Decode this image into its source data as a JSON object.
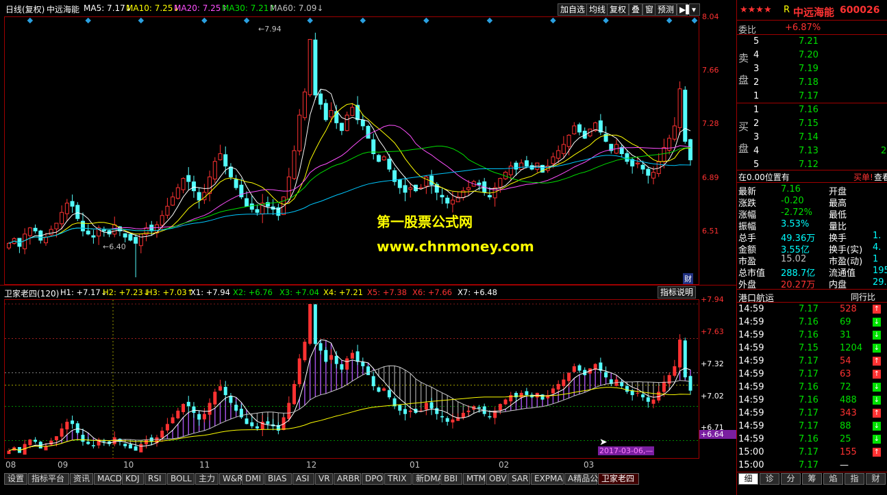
{
  "main": {
    "header": {
      "label": "日线(复权)",
      "stock_name": "中远海能",
      "ma5": "MA5: 7.17↓",
      "ma10": "MA10: 7.25↓",
      "ma20": "MA20: 7.25↑",
      "ma30": "MA30: 7.21↑",
      "ma60": "MA60: 7.09↓"
    },
    "buttons": [
      "加自选",
      "均线",
      "复权",
      "叠",
      "窗",
      "预测"
    ],
    "y_ticks": [
      "8.04",
      "7.66",
      "7.28",
      "6.89",
      "6.51"
    ],
    "annotations": {
      "high": "7.94",
      "low": "6.40"
    },
    "watermark1": "第一股票公式网",
    "watermark2": "www.chnmoney.com",
    "cai_label": "财"
  },
  "indicator": {
    "name": "卫家老四(120)",
    "values": [
      {
        "text": "H1: +7.17↓",
        "color": "#ffffff"
      },
      {
        "text": "H2: +7.23↓",
        "color": "#ffff00"
      },
      {
        "text": "H3: +7.03↑",
        "color": "#ffff00"
      },
      {
        "text": "X1: +7.94",
        "color": "#ffffff"
      },
      {
        "text": "X2: +6.76",
        "color": "#00e000"
      },
      {
        "text": "X3: +7.04",
        "color": "#00e000"
      },
      {
        "text": "X4: +7.21",
        "color": "#ffff00"
      },
      {
        "text": "X5: +7.38",
        "color": "#ff3232"
      },
      {
        "text": "X6: +7.66",
        "color": "#ff3232"
      },
      {
        "text": "X7: +6.48",
        "color": "#ffffff"
      }
    ],
    "help_button": "指标说明",
    "y_ticks": [
      "+7.94",
      "+7.63",
      "+7.32",
      "+7.02",
      "+6.71",
      "+6.64"
    ],
    "date_label": "2017-03-06,—"
  },
  "x_axis": [
    "08",
    "09",
    "10",
    "11",
    "12",
    "01",
    "02",
    "03"
  ],
  "tabs": [
    "设置",
    "指标平台",
    "资讯",
    "MACD",
    "KDJ",
    "RSI",
    "BOLL",
    "主力",
    "W&R",
    "DMI",
    "BIAS",
    "ASI",
    "VR",
    "ARBR",
    "DPO",
    "TRIX",
    "新DMA",
    "BBI",
    "MTM",
    "OBV",
    "SAR",
    "EXPMA",
    "A精品公式",
    "卫家老四"
  ],
  "right_panel": {
    "stars": "★★★★",
    "r": "R",
    "name": "中远海能",
    "code": "600026",
    "weibi_label": "委比",
    "weibi_value": "+6.87%",
    "sell_label": [
      "卖",
      "盘"
    ],
    "buy_label": [
      "买",
      "盘"
    ],
    "sell": [
      {
        "n": "5",
        "p": "7.21"
      },
      {
        "n": "4",
        "p": "7.20"
      },
      {
        "n": "3",
        "p": "7.19"
      },
      {
        "n": "2",
        "p": "7.18"
      },
      {
        "n": "1",
        "p": "7.17"
      }
    ],
    "buy": [
      {
        "n": "1",
        "p": "7.16",
        "v": ""
      },
      {
        "n": "2",
        "p": "7.15",
        "v": ""
      },
      {
        "n": "3",
        "p": "7.14",
        "v": ""
      },
      {
        "n": "4",
        "p": "7.13",
        "v": "2"
      },
      {
        "n": "5",
        "p": "7.12",
        "v": ""
      }
    ],
    "position_label": "在0.00位置有",
    "buy_action": "买单!",
    "view_action": "查看",
    "stats": [
      {
        "k": "最新",
        "v": "7.16",
        "vc": "#00e000",
        "k2": "开盘"
      },
      {
        "k": "涨跌",
        "v": "-0.20",
        "vc": "#00e000",
        "k2": "最高"
      },
      {
        "k": "涨幅",
        "v": "-2.72%",
        "vc": "#00e000",
        "k2": "最低"
      },
      {
        "k": "振幅",
        "v": "3.53%",
        "vc": "#00ffff",
        "k2": "量比"
      },
      {
        "k": "总手",
        "v": "49.36万",
        "vc": "#00ffff",
        "k2": "换手",
        "v2": "1."
      },
      {
        "k": "金额",
        "v": "3.55亿",
        "vc": "#00ffff",
        "k2": "换手(实)",
        "v2": "4."
      },
      {
        "k": "市盈",
        "v": "15.02",
        "vc": "#c0c0c0",
        "k2": "市盈(动)",
        "v2": "1"
      },
      {
        "k": "总市值",
        "v": "288.7亿",
        "vc": "#00ffff",
        "k2": "流通值",
        "v2": "195"
      },
      {
        "k": "外盘",
        "v": "20.27万",
        "vc": "#ff3232",
        "k2": "内盘",
        "v2": "29.0"
      }
    ],
    "industry_label": "港口航运",
    "industry_btn": "同行比",
    "ticks": [
      {
        "t": "14:59",
        "p": "7.17",
        "v": "528",
        "d": "up"
      },
      {
        "t": "14:59",
        "p": "7.16",
        "v": "69",
        "d": "down"
      },
      {
        "t": "14:59",
        "p": "7.16",
        "v": "31",
        "d": "down"
      },
      {
        "t": "14:59",
        "p": "7.15",
        "v": "1204",
        "d": "down"
      },
      {
        "t": "14:59",
        "p": "7.17",
        "v": "54",
        "d": "up"
      },
      {
        "t": "14:59",
        "p": "7.17",
        "v": "63",
        "d": "up"
      },
      {
        "t": "14:59",
        "p": "7.16",
        "v": "72",
        "d": "down"
      },
      {
        "t": "14:59",
        "p": "7.16",
        "v": "488",
        "d": "down"
      },
      {
        "t": "14:59",
        "p": "7.17",
        "v": "343",
        "d": "up"
      },
      {
        "t": "14:59",
        "p": "7.17",
        "v": "88",
        "d": "down"
      },
      {
        "t": "14:59",
        "p": "7.16",
        "v": "25",
        "d": "down"
      },
      {
        "t": "15:00",
        "p": "7.17",
        "v": "155",
        "d": "up"
      },
      {
        "t": "15:00",
        "p": "7.17",
        "v": "—",
        "d": ""
      }
    ],
    "bottom_tabs": [
      "细",
      "诊",
      "分",
      "筹",
      "焰",
      "指",
      "财"
    ]
  },
  "chart_data": {
    "type": "candlestick",
    "ylim": [
      6.4,
      8.04
    ],
    "ma_colors": {
      "ma5": "#ffffff",
      "ma10": "#ffff00",
      "ma20": "#ff50ff",
      "ma30": "#00e000",
      "ma60": "#00c8ff"
    },
    "closes": [
      6.62,
      6.65,
      6.6,
      6.68,
      6.72,
      6.7,
      6.64,
      6.66,
      6.71,
      6.75,
      6.82,
      6.88,
      6.86,
      6.78,
      6.7,
      6.68,
      6.66,
      6.72,
      6.7,
      6.68,
      6.74,
      6.7,
      6.66,
      6.64,
      6.62,
      6.68,
      6.72,
      6.7,
      6.74,
      6.8,
      6.86,
      6.92,
      6.98,
      7.04,
      7.02,
      6.96,
      6.9,
      6.95,
      7.05,
      7.15,
      7.2,
      7.12,
      7.05,
      6.98,
      6.92,
      6.86,
      6.84,
      6.82,
      6.88,
      6.86,
      6.84,
      6.8,
      6.92,
      7.05,
      7.22,
      7.45,
      7.6,
      7.94,
      7.58,
      7.52,
      7.42,
      7.48,
      7.4,
      7.35,
      7.45,
      7.5,
      7.42,
      7.38,
      7.3,
      7.2,
      7.15,
      7.18,
      7.1,
      7.02,
      6.98,
      6.95,
      6.98,
      6.96,
      6.98,
      7.05,
      7.0,
      6.95,
      6.92,
      6.88,
      6.9,
      6.92,
      6.96,
      6.98,
      7.02,
      7.0,
      6.95,
      6.92,
      6.98,
      7.04,
      7.08,
      7.12,
      7.1,
      7.14,
      7.12,
      7.1,
      7.14,
      7.08,
      7.12,
      7.18,
      7.22,
      7.26,
      7.32,
      7.38,
      7.34,
      7.3,
      7.36,
      7.4,
      7.34,
      7.28,
      7.22,
      7.26,
      7.2,
      7.15,
      7.12,
      7.14,
      7.1,
      7.06,
      7.08,
      7.15,
      7.24,
      7.3,
      7.38,
      7.62,
      7.28,
      7.16
    ]
  }
}
